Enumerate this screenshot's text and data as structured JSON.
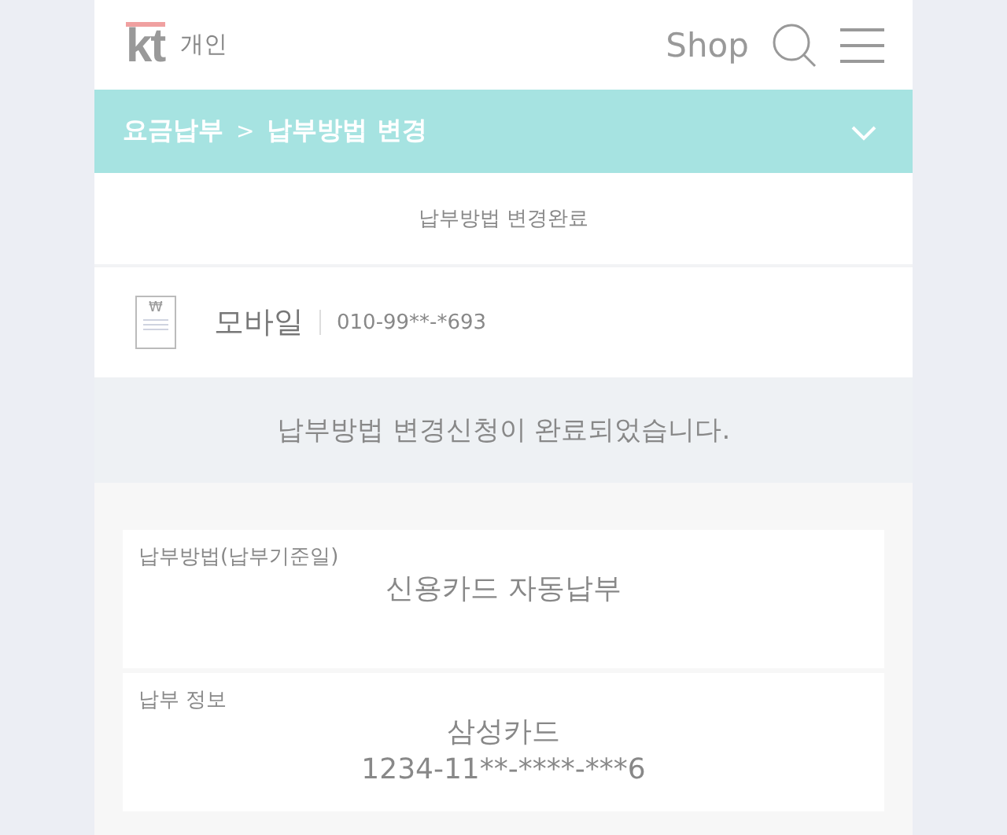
{
  "header": {
    "logo": "kt",
    "section": "개인",
    "shop_link": "Shop"
  },
  "breadcrumb": {
    "items": [
      "요금납부",
      "납부방법 변경"
    ],
    "separator": ">",
    "expanded": false
  },
  "page_title": "납부방법 변경완료",
  "account": {
    "bill_symbol": "₩",
    "service": "모바일",
    "number": "010-99**-*693"
  },
  "message": "납부방법 변경신청이 완료되었습니다.",
  "cards": [
    {
      "label": "납부방법(납부기준일)",
      "lines": [
        "신용카드 자동납부"
      ]
    },
    {
      "label": "납부 정보",
      "lines": [
        "삼성카드",
        "1234-11**-****-***6"
      ]
    }
  ]
}
